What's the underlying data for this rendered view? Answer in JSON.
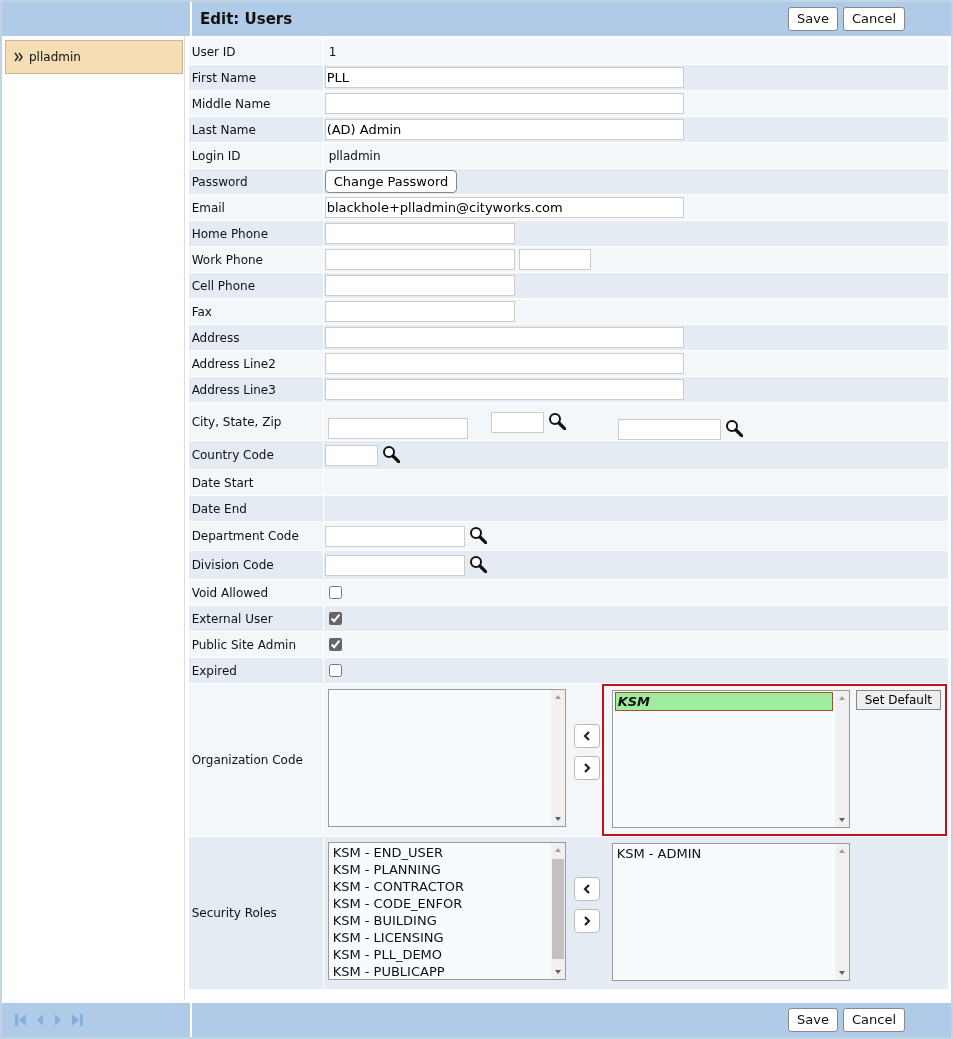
{
  "sidebar": {
    "items": [
      {
        "label": "plladmin",
        "selected": true
      }
    ]
  },
  "header": {
    "title": "Edit: Users",
    "buttons": [
      "Save",
      "Cancel"
    ]
  },
  "rows": [
    {
      "label": "User ID",
      "kind": "text",
      "value": "1"
    },
    {
      "label": "First Name",
      "kind": "fields",
      "fields": [
        {
          "value": "PLL",
          "kind": "wide"
        }
      ]
    },
    {
      "label": "Middle Name",
      "kind": "fields",
      "fields": [
        {
          "kind": "wide"
        }
      ]
    },
    {
      "label": "Last Name",
      "kind": "fields",
      "fields": [
        {
          "value": "(AD) Admin",
          "kind": "wide"
        }
      ]
    },
    {
      "label": "Login ID",
      "kind": "text",
      "value": "plladmin"
    },
    {
      "label": "Password",
      "kind": "button",
      "button": "Change Password"
    },
    {
      "label": "Email",
      "kind": "fields",
      "fields": [
        {
          "value": "blackhole+plladmin@cityworks.com",
          "kind": "wide"
        }
      ]
    },
    {
      "label": "Home Phone",
      "kind": "fields",
      "fields": [
        {
          "kind": "medium"
        }
      ]
    },
    {
      "label": "Work Phone",
      "kind": "fields",
      "fields": [
        {
          "kind": "medium"
        },
        {
          "kind": "small"
        }
      ]
    },
    {
      "label": "Cell Phone",
      "kind": "fields",
      "fields": [
        {
          "kind": "medium"
        }
      ]
    },
    {
      "label": "Fax",
      "kind": "fields",
      "fields": [
        {
          "kind": "medium"
        }
      ]
    },
    {
      "label": "Address",
      "kind": "fields",
      "fields": [
        {
          "kind": "wide"
        }
      ]
    },
    {
      "label": "Address Line2",
      "kind": "fields",
      "fields": [
        {
          "kind": "wide"
        }
      ]
    },
    {
      "label": "Address Line3",
      "kind": "fields",
      "fields": [
        {
          "kind": "wide"
        }
      ]
    },
    {
      "label": "City, State, Zip",
      "kind": "address",
      "fields": [
        {
          "kind": "city"
        },
        {
          "kind": "tiny",
          "lookup": true
        },
        {
          "kind": "zip",
          "lookup": true
        }
      ]
    },
    {
      "label": "Country Code",
      "kind": "fields",
      "fields": [
        {
          "kind": "tiny",
          "lookup": true
        }
      ]
    },
    {
      "label": "Date Start",
      "kind": "empty"
    },
    {
      "label": "Date End",
      "kind": "empty"
    },
    {
      "label": "Department Code",
      "kind": "fields",
      "fields": [
        {
          "kind": "code",
          "lookup": true
        }
      ]
    },
    {
      "label": "Division Code",
      "kind": "fields",
      "fields": [
        {
          "kind": "code",
          "lookup": true
        }
      ]
    },
    {
      "label": "Void Allowed",
      "kind": "checkbox",
      "checked": false
    },
    {
      "label": "External User",
      "kind": "checkbox",
      "checked": true
    },
    {
      "label": "Public Site Admin",
      "kind": "checkbox",
      "checked": true
    },
    {
      "label": "Expired",
      "kind": "checkbox",
      "checked": false
    },
    {
      "label": "Organization Code",
      "kind": "listpair",
      "highlighted": true,
      "available": [],
      "assigned": [
        {
          "label": "KSM",
          "selected": true
        }
      ],
      "extra_button": "Set Default"
    },
    {
      "label": "Security Roles",
      "kind": "listpair",
      "highlighted": false,
      "scrollable": true,
      "available": [
        {
          "label": "KSM - END_USER",
          "selected": false
        },
        {
          "label": "KSM - PLANNING",
          "selected": false
        },
        {
          "label": "KSM - CONTRACTOR",
          "selected": false
        },
        {
          "label": "KSM - CODE_ENFOR",
          "selected": false
        },
        {
          "label": "KSM - BUILDING",
          "selected": false
        },
        {
          "label": "KSM - LICENSING",
          "selected": false
        },
        {
          "label": "KSM - PLL_DEMO",
          "selected": false
        },
        {
          "label": "KSM - PUBLICAPP",
          "selected": false
        }
      ],
      "assigned": [
        {
          "label": "KSM - ADMIN",
          "selected": false
        }
      ]
    }
  ],
  "footer": {
    "pager_disabled": true,
    "buttons": [
      "Save",
      "Cancel"
    ]
  }
}
